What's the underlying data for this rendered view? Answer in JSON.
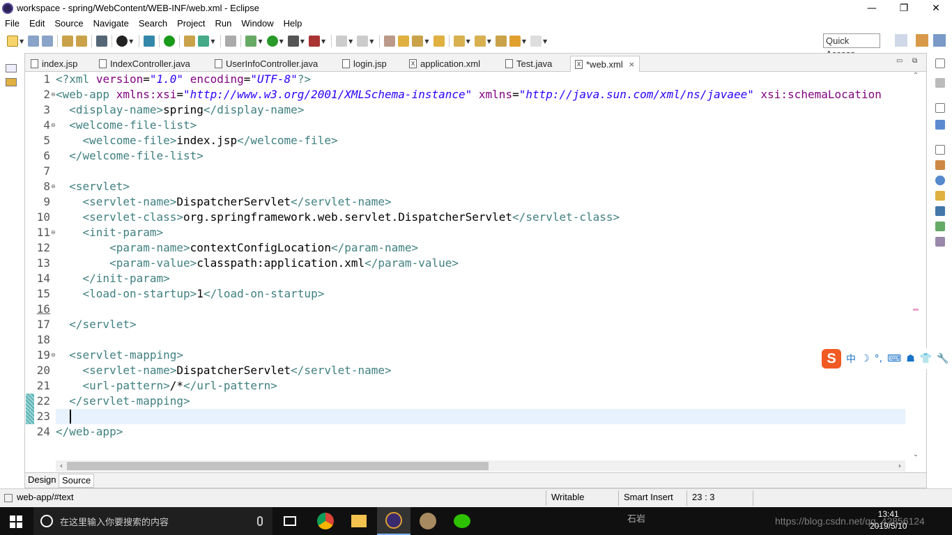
{
  "window": {
    "title": "workspace - spring/WebContent/WEB-INF/web.xml - Eclipse",
    "controls": [
      "—",
      "❐",
      "✕"
    ]
  },
  "menu": [
    "File",
    "Edit",
    "Source",
    "Navigate",
    "Search",
    "Project",
    "Run",
    "Window",
    "Help"
  ],
  "toolbar": {
    "quick_access": "Quick Access"
  },
  "editor": {
    "tabs": [
      {
        "label": "index.jsp",
        "icon": "jsp-file-icon"
      },
      {
        "label": "IndexController.java",
        "icon": "java-file-icon"
      },
      {
        "label": "UserInfoController.java",
        "icon": "java-file-icon"
      },
      {
        "label": "login.jsp",
        "icon": "jsp-file-icon"
      },
      {
        "label": "application.xml",
        "icon": "xml-file-icon"
      },
      {
        "label": "Test.java",
        "icon": "java-file-icon"
      },
      {
        "label": "*web.xml",
        "icon": "xml-file-icon",
        "active": true
      }
    ],
    "line_numbers": [
      "1",
      "2",
      "3",
      "4",
      "5",
      "6",
      "7",
      "8",
      "9",
      "10",
      "11",
      "12",
      "13",
      "14",
      "15",
      "16",
      "17",
      "18",
      "19",
      "20",
      "21",
      "22",
      "23",
      "24"
    ],
    "bottom_tabs": [
      "Design",
      "Source"
    ],
    "active_bottom_tab": "Source"
  },
  "status": {
    "path": "web-app/#text",
    "mode": "Writable",
    "insert": "Smart Insert",
    "position": "23 : 3"
  },
  "ime": {
    "logo": "S",
    "items": [
      "中",
      "☽",
      "°,",
      "⌨",
      "☗",
      "👕",
      "🔧"
    ]
  },
  "taskbar": {
    "search_placeholder": "在这里输入你要搜索的内容",
    "time": "13:41",
    "date": "2019/5/10",
    "watermark": "https://blog.csdn.net/qq_42856124",
    "bg_text": "石岩"
  },
  "colors": {
    "tag": "#3f7f7f",
    "attribute": "#7f007f",
    "string": "#2a00ff",
    "current_line": "#e8f2fe"
  }
}
